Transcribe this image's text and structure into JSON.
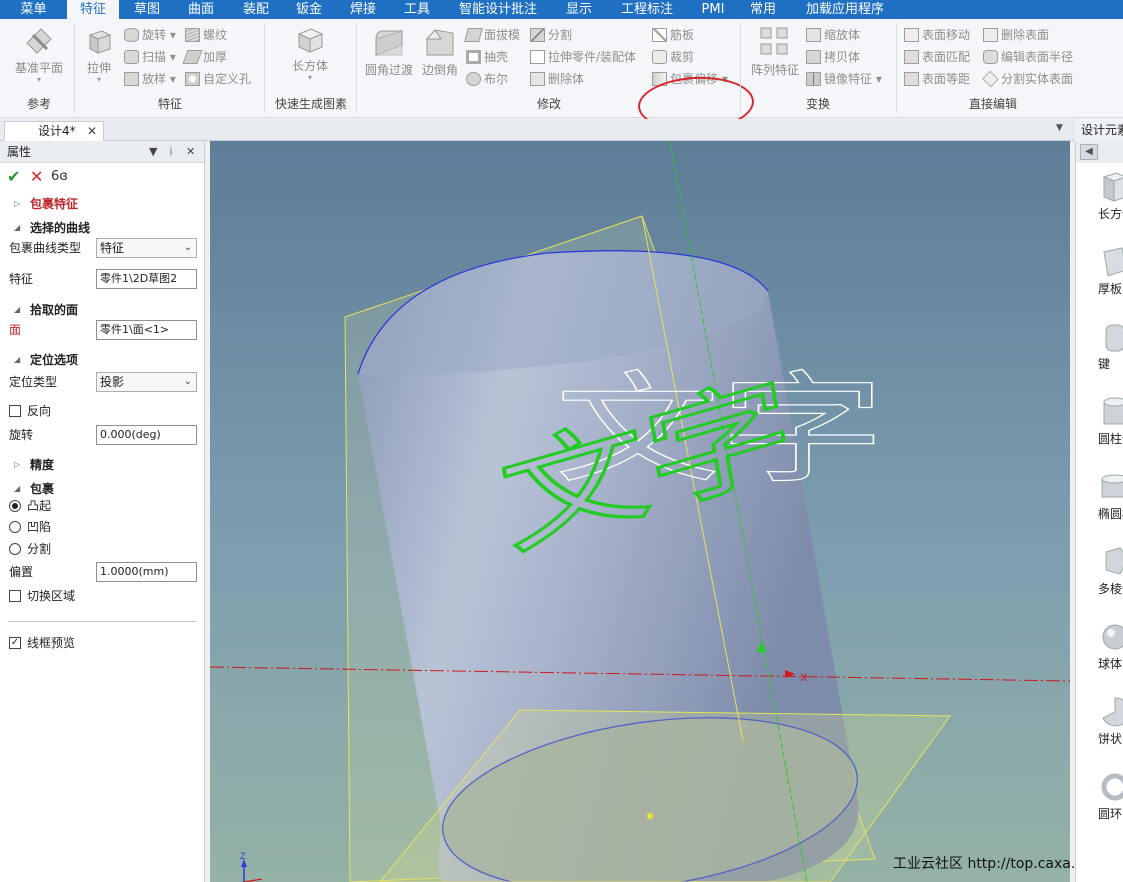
{
  "menu": {
    "tabs": [
      {
        "label": "菜单"
      },
      {
        "label": "特征"
      },
      {
        "label": "草图"
      },
      {
        "label": "曲面"
      },
      {
        "label": "装配"
      },
      {
        "label": "钣金"
      },
      {
        "label": "焊接"
      },
      {
        "label": "工具"
      },
      {
        "label": "智能设计批注"
      },
      {
        "label": "显示"
      },
      {
        "label": "工程标注"
      },
      {
        "label": "PMI"
      },
      {
        "label": "常用"
      },
      {
        "label": "加载应用程序"
      }
    ],
    "active": "特征"
  },
  "ribbon": {
    "groups": {
      "ref": "参考",
      "feature": "特征",
      "quick": "快速生成图素",
      "modify": "修改",
      "transform": "变换",
      "direct": "直接编辑"
    },
    "buttons": {
      "datum_plane": "基准平面",
      "extrude": "拉伸",
      "rotate": "旋转",
      "thread": "螺纹",
      "sweep": "扫描",
      "thicken": "加厚",
      "loft": "放样",
      "custom_hole": "自定义孔",
      "box": "长方体",
      "fillet": "圆角过渡",
      "chamfer": "边倒角",
      "draft": "面拔模",
      "split": "分割",
      "shell": "抽壳",
      "extrude_part": "拉伸零件/装配体",
      "boolean": "布尔",
      "delete_body": "删除体",
      "rib": "筋板",
      "trim": "裁剪",
      "wrap_offset": "包裹偏移",
      "pattern": "阵列特征",
      "scale": "缩放体",
      "copy_body": "拷贝体",
      "mirror": "镜像特征",
      "move_face": "表面移动",
      "match_face": "表面匹配",
      "equidistant_face": "表面等距",
      "delete_face": "删除表面",
      "edit_radius": "编辑表面半径",
      "split_solid": "分割实体表面"
    }
  },
  "document": {
    "tab": "设计4*",
    "right_panel_title": "设计元素"
  },
  "properties": {
    "header": "属性",
    "feature_title": "包裹特征",
    "sec_curve": "选择的曲线",
    "curve_type_label": "包裹曲线类型",
    "curve_type_value": "特征",
    "feature_label": "特征",
    "feature_value": "零件1\\2D草图2",
    "sec_face": "拾取的面",
    "face_label": "面",
    "face_value": "零件1\\面<1>",
    "sec_position": "定位选项",
    "position_type_label": "定位类型",
    "position_type_value": "投影",
    "reverse_label": "反向",
    "rotation_label": "旋转",
    "rotation_value": "0.000(deg)",
    "sec_precision": "精度",
    "sec_wrap": "包裹",
    "emboss": "凸起",
    "deboss": "凹陷",
    "split": "分割",
    "offset_label": "偏置",
    "offset_value": "1.0000(mm)",
    "toggle_region": "切换区域",
    "wireframe_preview": "线框预览",
    "selected_wrap_mode": "凸起",
    "wireframe_preview_checked": true
  },
  "viewport": {
    "text_white": "文字",
    "text_green": "文字",
    "axis_x": "X",
    "axis_z": "Z",
    "watermark": "工业云社区 http://top.caxa.com/"
  },
  "design_elements": [
    {
      "label": "长方体"
    },
    {
      "label": "厚板"
    },
    {
      "label": "键"
    },
    {
      "label": "圆柱体"
    },
    {
      "label": "椭圆柱"
    },
    {
      "label": "多棱体"
    },
    {
      "label": "球体"
    },
    {
      "label": "饼状"
    },
    {
      "label": "圆环"
    }
  ],
  "colors": {
    "menu_bar": "#1f6fc2",
    "highlight_circle": "#d8262a",
    "feature_title": "#c0262a",
    "curve_green": "#22cc22",
    "viewport_top": "#5d7d98",
    "viewport_bottom": "#94b2a6"
  }
}
